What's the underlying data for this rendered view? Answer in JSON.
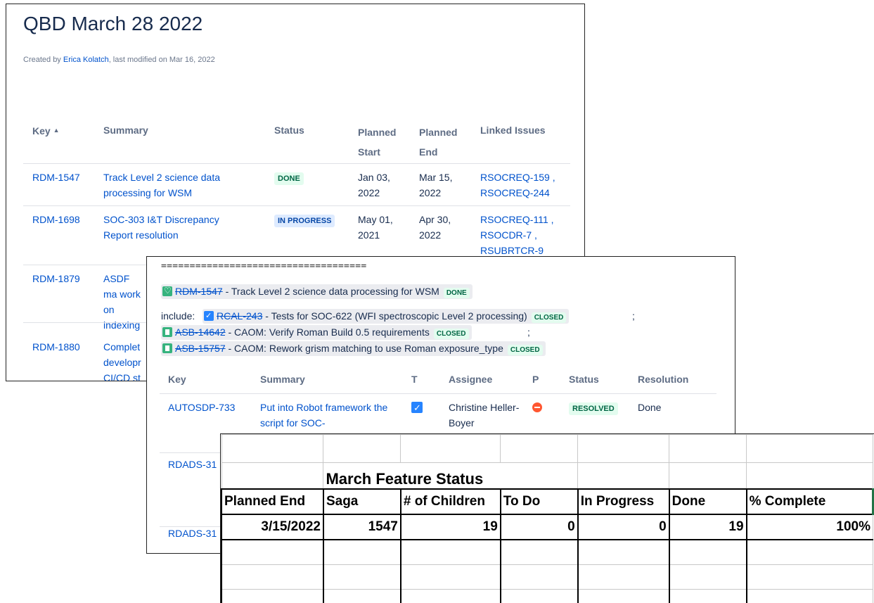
{
  "win1": {
    "title": "QBD March 28 2022",
    "byline_prefix": "Created by ",
    "byline_author": "Erica Kolatch",
    "byline_suffix": ", last modified on Mar 16, 2022",
    "columns": [
      "Key",
      "Summary",
      "Status",
      "Planned Start",
      "Planned End",
      "Linked Issues"
    ],
    "sort_icon": "sort-ascending-icon",
    "rows": [
      {
        "key": "RDM-1547",
        "summary": "Track Level 2 science data processing for WSM",
        "status": "DONE",
        "start": "Jan 03, 2022",
        "end": "Mar 15, 2022",
        "links": "RSOCREQ-159 , RSOCREQ-244"
      },
      {
        "key": "RDM-1698",
        "summary": "SOC-303 I&T Discrepancy Report resolution",
        "status": "IN PROGRESS",
        "start": "May 01, 2021",
        "end": "Apr 30, 2022",
        "links": "RSOCREQ-111 , RSOCDR-7 , RSUBRTCR-9"
      },
      {
        "key": "RDM-1879",
        "summary": "ASDF ma work on indexing"
      },
      {
        "key": "RDM-1880",
        "summary": "Complet developr CI/CD st"
      }
    ]
  },
  "win2": {
    "separator": "====================================",
    "epic": {
      "icon": "heart-icon",
      "key": "RDM-1547",
      "text": " - Track Level 2 science data processing for WSM",
      "status": "DONE"
    },
    "include_label": "include:",
    "includes": [
      {
        "icon": "checkbox-icon",
        "key": "RCAL-243",
        "text": " - Tests for SOC-622 (WFI spectroscopic Level 2 processing)",
        "status": "CLOSED",
        "suffix": " ;"
      },
      {
        "icon": "story-icon",
        "key": "ASB-14642",
        "text": " - CAOM: Verify Roman Build 0.5 requirements",
        "status": "CLOSED",
        "suffix": " ;"
      },
      {
        "icon": "story-icon",
        "key": "ASB-15757",
        "text": " - CAOM: Rework grism matching to use Roman exposure_type",
        "status": "CLOSED",
        "suffix": ""
      }
    ],
    "columns": [
      "Key",
      "Summary",
      "T",
      "Assignee",
      "P",
      "Status",
      "Resolution"
    ],
    "rows": [
      {
        "key": "AUTOSDP-733",
        "summary": "Put into Robot framework the script for SOC-",
        "assignee": "Christine Heller-Boyer",
        "status": "RESOLVED",
        "resolution": "Done"
      },
      {
        "key": "RDADS-31"
      },
      {
        "key": "RDADS-31"
      }
    ]
  },
  "win3": {
    "title": "March Feature Status",
    "headers": [
      "Planned End",
      "Saga",
      "# of Children",
      "To Do",
      "In Progress",
      "Done",
      "% Complete"
    ],
    "values": [
      "3/15/2022",
      "1547",
      "19",
      "0",
      "0",
      "19",
      "100%"
    ]
  }
}
